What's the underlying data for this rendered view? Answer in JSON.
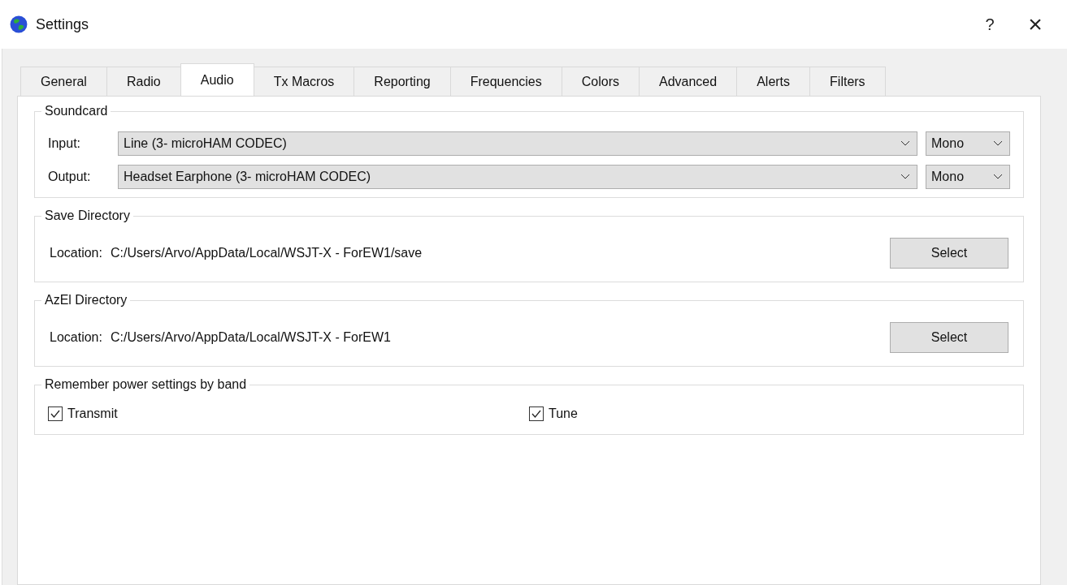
{
  "window": {
    "title": "Settings",
    "help": "?",
    "close": "×"
  },
  "tabs": [
    {
      "label": "General",
      "selected": false
    },
    {
      "label": "Radio",
      "selected": false
    },
    {
      "label": "Audio",
      "selected": true
    },
    {
      "label": "Tx Macros",
      "selected": false
    },
    {
      "label": "Reporting",
      "selected": false
    },
    {
      "label": "Frequencies",
      "selected": false
    },
    {
      "label": "Colors",
      "selected": false
    },
    {
      "label": "Advanced",
      "selected": false
    },
    {
      "label": "Alerts",
      "selected": false
    },
    {
      "label": "Filters",
      "selected": false
    }
  ],
  "soundcard": {
    "title": "Soundcard",
    "rows": [
      {
        "label": "Input:",
        "device": "Line (3- microHAM CODEC)",
        "channel": "Mono"
      },
      {
        "label": "Output:",
        "device": "Headset Earphone (3- microHAM CODEC)",
        "channel": "Mono"
      }
    ]
  },
  "directories": [
    {
      "title": "Save Directory",
      "label": "Location:",
      "path": "C:/Users/Arvo/AppData/Local/WSJT-X - ForEW1/save",
      "button": "Select"
    },
    {
      "title": "AzEl Directory",
      "label": "Location:",
      "path": "C:/Users/Arvo/AppData/Local/WSJT-X - ForEW1",
      "button": "Select"
    }
  ],
  "power": {
    "title": "Remember power settings by band",
    "options": [
      {
        "label": "Transmit",
        "checked": true
      },
      {
        "label": "Tune",
        "checked": true
      }
    ]
  }
}
